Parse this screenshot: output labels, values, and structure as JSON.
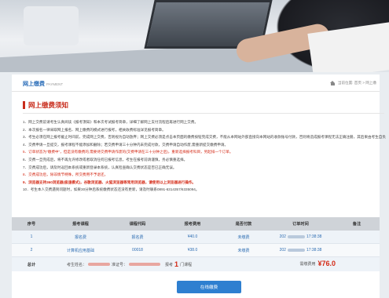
{
  "header": {
    "title": "网上缴费",
    "subtitle": "PAYMENT",
    "breadcrumb": "当前位置: 首页 > 网上缴"
  },
  "notice": {
    "title": "网上缴费须知",
    "rules": [
      {
        "text": "1．网上交费前请考生认真阅读《报考须知》和本次考试报考简章，详细了解网上支付流程后再进行网上交费。",
        "style": "normal"
      },
      {
        "text": "2．本次报名一律采取网上报名、网上缴费的模式进行报考，相关收费标准详见报考简章。",
        "style": "normal"
      },
      {
        "text": "3．考生必须在网上报考截止时间前，完成网上交费，否则视为自动放弃；网上交费必须是点击本页面的缴费按钮完成交费，不能从本网站外部直接向本网站的收款账号付款，否则将造成报考课程无法正确注册，其后果由考生自负。",
        "style": "normal"
      },
      {
        "text": "4．交费申请一旦提交，报考课程不能添加和删除；若交费申请三十分钟内未完成付款，交费申请自动作废,需重新提交缴费申请。",
        "style": "normal"
      },
      {
        "text": "5．订单状态为\"缴费中\"，但是没有缴费的,需要待交费申请作废的(交费申请在三十分钟之后)，重新选择报考科目，另起排一个订单。",
        "style": "red"
      },
      {
        "text": "6．交费一旦完成后，将不再允许修改或者取消任何已报考信息，考生在报考前请谨慎，务必慎重选择。",
        "style": "normal"
      },
      {
        "text": "7．交费成功后，请及时返回本系统或重新登录本系统，认真检查确认交费状态是否已正确无误。",
        "style": "normal"
      },
      {
        "text": "8．交费成功后，除非情节特殊，所交费用不予退还。",
        "style": "red"
      },
      {
        "text": "9．浏览器支持360浏览器(极速模式)，谷歌浏览器、火狐浏览器等常用浏览器，请使用以上浏览器进行操作。",
        "style": "red-bold"
      },
      {
        "text": "10．考生本人交费遇到问题时，如果30分钟后系统缴费状态还没有更新，请及时联系0891-6314357/6335094。",
        "style": "normal"
      }
    ]
  },
  "table": {
    "headers": [
      "序号",
      "报考课程",
      "课程代码",
      "报考费用",
      "是否付款",
      "订单时间",
      "备注"
    ],
    "rows": [
      {
        "index": "1",
        "course": "报名费",
        "code": "报名费",
        "fee": "¥40.0",
        "paid": "未缴费",
        "time_prefix": "202",
        "time_suffix": "17:38:38",
        "note": ""
      },
      {
        "index": "2",
        "course": "计算机应用基础",
        "code": "00018",
        "fee": "¥38.0",
        "paid": "未缴费",
        "time_prefix": "202",
        "time_suffix": "17:38:38",
        "note": ""
      }
    ],
    "summary": {
      "label": "总计",
      "name_label": "考生姓名：",
      "id_label": "准证号：",
      "count_prefix": "报考",
      "count": "1",
      "count_suffix": "门课程",
      "fee_label": "需缴费用",
      "fee_amount": "¥76.0"
    }
  },
  "pay_button_label": "在线缴费",
  "colors": {
    "accent_blue": "#2e7fd0",
    "notice_red": "#c82c1c",
    "link_blue": "#2f6eb3"
  }
}
